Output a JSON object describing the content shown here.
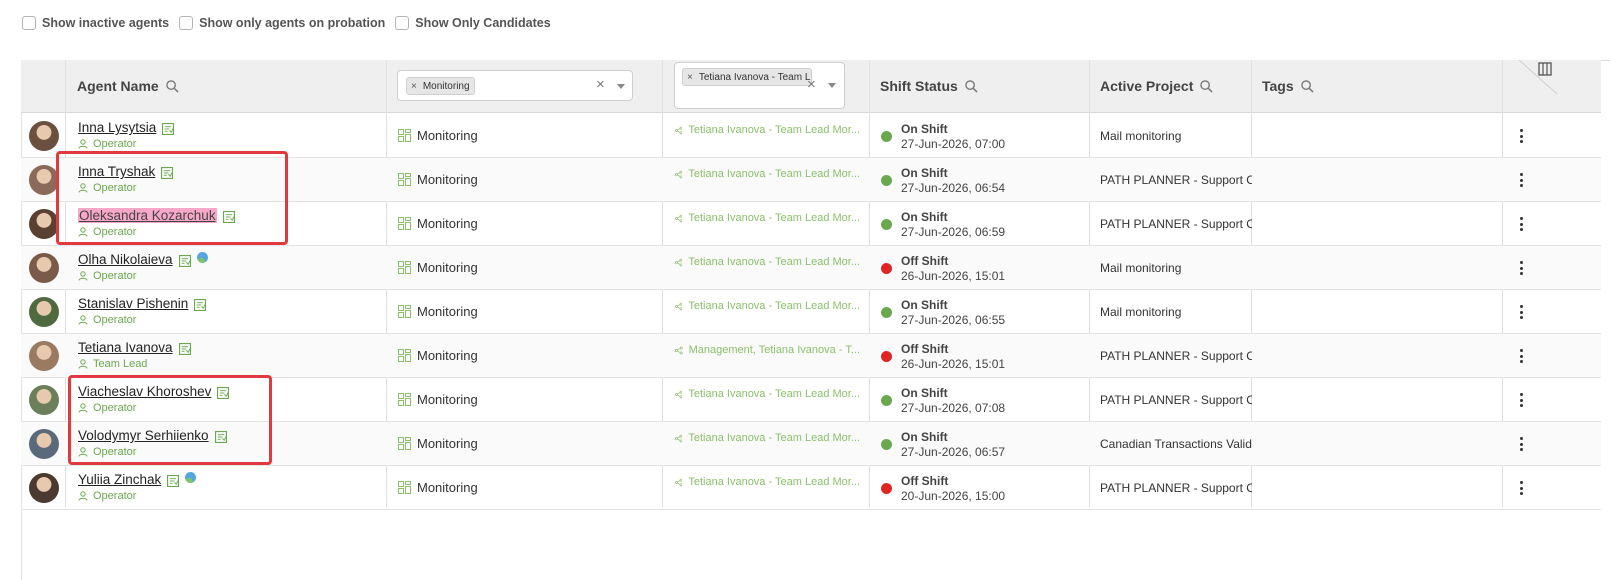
{
  "filters": [
    {
      "label": "Show inactive agents",
      "checked": false
    },
    {
      "label": "Show only agents on probation",
      "checked": false
    },
    {
      "label": "Show Only Candidates",
      "checked": false
    }
  ],
  "header": {
    "agent_name": "Agent Name",
    "project_chip": "Monitoring",
    "team_chip": "Tetiana Ivanova - Team L",
    "shift_status": "Shift Status",
    "active_project": "Active Project",
    "tags": "Tags"
  },
  "rows": [
    {
      "name": "Inna Lysytsia",
      "role": "Operator",
      "globe": false,
      "project": "Monitoring",
      "team": "Tetiana Ivanova - Team Lead Mor...",
      "status": "On Shift",
      "status_color": "#6aa84f",
      "time": "27-Jun-2026, 07:00",
      "active_project": "Mail monitoring",
      "highlight": false
    },
    {
      "name": "Inna Tryshak",
      "role": "Operator",
      "globe": false,
      "project": "Monitoring",
      "team": "Tetiana Ivanova - Team Lead Mor...",
      "status": "On Shift",
      "status_color": "#6aa84f",
      "time": "27-Jun-2026, 06:54",
      "active_project": "PATH PLANNER - Support Cha",
      "highlight": false
    },
    {
      "name": "Oleksandra Kozarchuk",
      "role": "Operator",
      "globe": false,
      "project": "Monitoring",
      "team": "Tetiana Ivanova - Team Lead Mor...",
      "status": "On Shift",
      "status_color": "#6aa84f",
      "time": "27-Jun-2026, 06:59",
      "active_project": "PATH PLANNER - Support Cha",
      "highlight": true
    },
    {
      "name": "Olha Nikolaieva",
      "role": "Operator",
      "globe": true,
      "project": "Monitoring",
      "team": "Tetiana Ivanova - Team Lead Mor...",
      "status": "Off Shift",
      "status_color": "#e02424",
      "time": "26-Jun-2026, 15:01",
      "active_project": "Mail monitoring",
      "highlight": false
    },
    {
      "name": "Stanislav Pishenin",
      "role": "Operator",
      "globe": false,
      "project": "Monitoring",
      "team": "Tetiana Ivanova - Team Lead Mor...",
      "status": "On Shift",
      "status_color": "#6aa84f",
      "time": "27-Jun-2026, 06:55",
      "active_project": "Mail monitoring",
      "highlight": false
    },
    {
      "name": "Tetiana Ivanova",
      "role": "Team Lead",
      "globe": false,
      "project": "Monitoring",
      "team": "Management, Tetiana Ivanova - T...",
      "status": "Off Shift",
      "status_color": "#e02424",
      "time": "26-Jun-2026, 15:01",
      "active_project": "PATH PLANNER - Support Cha",
      "highlight": false
    },
    {
      "name": "Viacheslav Khoroshev",
      "role": "Operator",
      "globe": false,
      "project": "Monitoring",
      "team": "Tetiana Ivanova - Team Lead Mor...",
      "status": "On Shift",
      "status_color": "#6aa84f",
      "time": "27-Jun-2026, 07:08",
      "active_project": "PATH PLANNER - Support Cha",
      "highlight": false
    },
    {
      "name": "Volodymyr Serhiienko",
      "role": "Operator",
      "globe": false,
      "project": "Monitoring",
      "team": "Tetiana Ivanova - Team Lead Mor...",
      "status": "On Shift",
      "status_color": "#6aa84f",
      "time": "27-Jun-2026, 06:57",
      "active_project": "Canadian Transactions Validat",
      "highlight": false
    },
    {
      "name": "Yuliia Zinchak",
      "role": "Operator",
      "globe": true,
      "project": "Monitoring",
      "team": "Tetiana Ivanova - Team Lead Mor...",
      "status": "Off Shift",
      "status_color": "#e02424",
      "time": "20-Jun-2026, 15:00",
      "active_project": "PATH PLANNER - Support Cha",
      "highlight": false
    }
  ],
  "icons": {
    "search": "search-icon",
    "columns": "columns-icon",
    "profile": "profile-card-icon",
    "user": "user-icon",
    "project": "grid-icon",
    "team": "share-icon",
    "globe": "globe-icon",
    "menu": "kebab-menu-icon"
  },
  "colors": {
    "accent_green": "#6aa84f",
    "on_shift": "#6aa84f",
    "off_shift": "#e02424",
    "annotation_red": "#e0393e",
    "name_highlight": "#f7a8c8"
  }
}
